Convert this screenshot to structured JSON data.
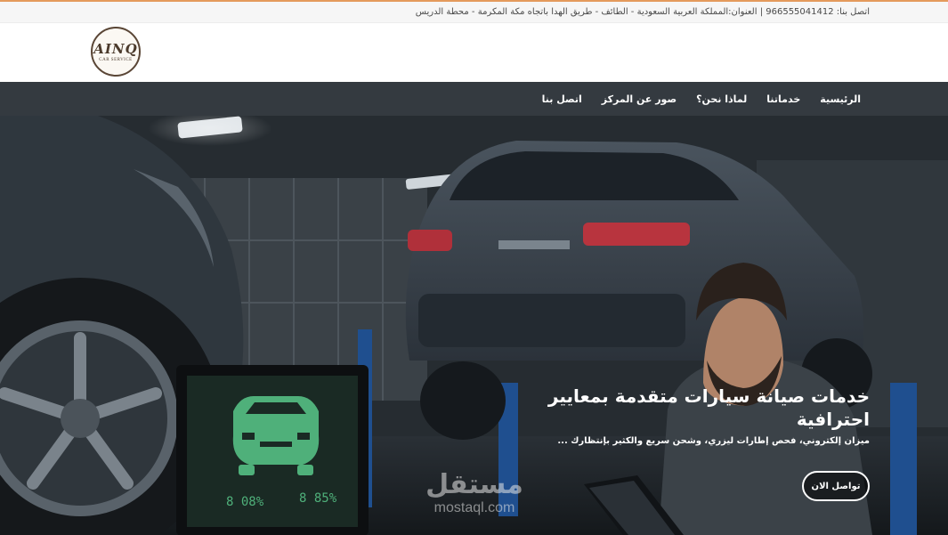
{
  "topbar": {
    "contact_text": "اتصل بنا: 966555041412 | العنوان:المملكة العربية السعودية - الطائف - طريق الهدا باتجاه مكة المكرمة - محطة الدريس"
  },
  "brand": {
    "logo_main": "AINQ",
    "logo_sub": "CAR SERVICE"
  },
  "nav": {
    "items": [
      {
        "label": "الرئيسية"
      },
      {
        "label": "خدماتنا"
      },
      {
        "label": "لماذا نحن؟"
      },
      {
        "label": "صور عن المركز"
      },
      {
        "label": "اتصل بنا"
      }
    ]
  },
  "hero": {
    "title": "خدمات صيانة سيارات متقدمة بمعايير احترافية",
    "subtitle": "ميزان إلكتروني، فحص إطارات ليزري، وشحن سريع والكثير بإنتظارك ...",
    "cta_label": "تواصل الان",
    "monitor_readout_left": "8 08%",
    "monitor_readout_right": "8 85%"
  },
  "watermark": {
    "arabic": "مستقل",
    "latin": "mostaql.com"
  },
  "colors": {
    "topbar_accent": "#e49a5c",
    "navbar_bg": "#343a40",
    "monitor_green": "#4fb07a"
  }
}
